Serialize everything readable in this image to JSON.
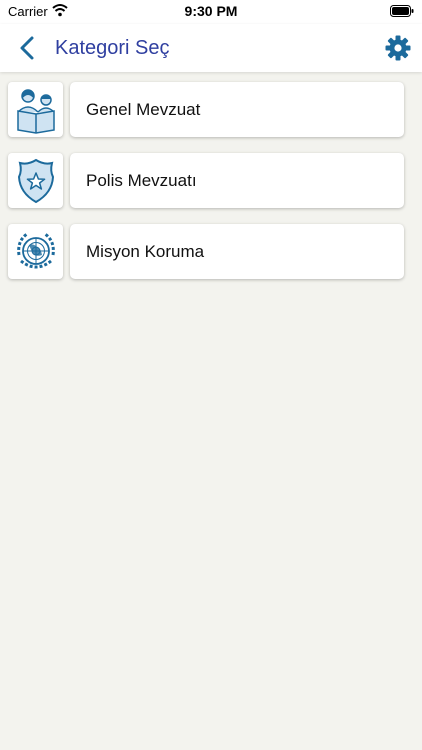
{
  "status_bar": {
    "carrier": "Carrier",
    "time": "9:30 PM"
  },
  "header": {
    "title": "Kategori Seç",
    "back_icon": "chevron-left-icon",
    "settings_icon": "gear-icon"
  },
  "colors": {
    "accent": "#2f3fa0",
    "icon_blue": "#1c6a9c",
    "background": "#f3f3ee"
  },
  "categories": [
    {
      "label": "Genel Mevzuat",
      "icon": "people-reading-icon"
    },
    {
      "label": "Polis Mevzuatı",
      "icon": "police-badge-icon"
    },
    {
      "label": "Misyon Koruma",
      "icon": "un-emblem-icon"
    }
  ]
}
